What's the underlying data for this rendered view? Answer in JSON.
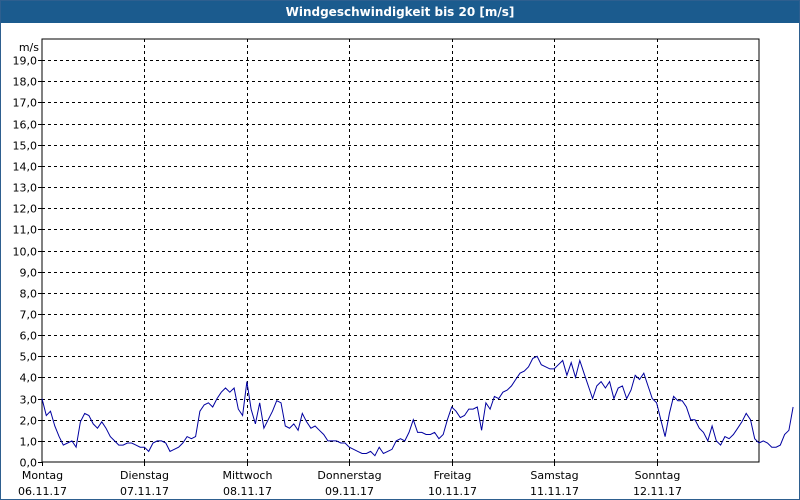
{
  "window": {
    "title": "Windgeschwindigkeit bis 20 [m/s]"
  },
  "chart_data": {
    "type": "line",
    "title": "Windgeschwindigkeit bis 20 [m/s]",
    "ylabel": "m/s",
    "ylim": [
      0,
      20
    ],
    "yticks": [
      "0,0",
      "1,0",
      "2,0",
      "3,0",
      "4,0",
      "5,0",
      "6,0",
      "7,0",
      "8,0",
      "9,0",
      "10,0",
      "11,0",
      "12,0",
      "13,0",
      "14,0",
      "15,0",
      "16,0",
      "17,0",
      "18,0",
      "19,0"
    ],
    "x_days": [
      {
        "day": "Montag",
        "date": "06.11.17"
      },
      {
        "day": "Dienstag",
        "date": "07.11.17"
      },
      {
        "day": "Mittwoch",
        "date": "08.11.17"
      },
      {
        "day": "Donnerstag",
        "date": "09.11.17"
      },
      {
        "day": "Freitag",
        "date": "10.11.17"
      },
      {
        "day": "Samstag",
        "date": "11.11.17"
      },
      {
        "day": "Sonntag",
        "date": "12.11.17"
      }
    ],
    "grid": true,
    "line_color": "#0000a0",
    "series": [
      {
        "points_per_day": 24,
        "values": [
          3.0,
          2.2,
          2.4,
          1.7,
          1.2,
          0.8,
          0.9,
          1.0,
          0.7,
          1.9,
          2.3,
          2.2,
          1.8,
          1.6,
          1.9,
          1.6,
          1.2,
          1.0,
          0.8,
          0.8,
          0.9,
          0.9,
          0.8,
          0.7,
          0.7,
          0.5,
          0.9,
          1.0,
          1.0,
          0.9,
          0.5,
          0.6,
          0.7,
          0.9,
          1.2,
          1.1,
          1.2,
          2.4,
          2.7,
          2.8,
          2.6,
          3.0,
          3.3,
          3.5,
          3.3,
          3.5,
          2.5,
          2.2,
          3.8,
          2.5,
          1.8,
          2.8,
          1.6,
          2.0,
          2.4,
          2.9,
          2.8,
          1.7,
          1.6,
          1.8,
          1.5,
          2.3,
          1.9,
          1.6,
          1.7,
          1.5,
          1.3,
          1.0,
          1.0,
          1.0,
          0.9,
          0.9,
          0.7,
          0.6,
          0.5,
          0.4,
          0.4,
          0.5,
          0.3,
          0.7,
          0.4,
          0.5,
          0.6,
          1.0,
          1.1,
          1.0,
          1.4,
          2.0,
          1.4,
          1.4,
          1.3,
          1.3,
          1.4,
          1.1,
          1.3,
          2.0,
          2.6,
          2.4,
          2.1,
          2.2,
          2.5,
          2.5,
          2.6,
          1.5,
          2.8,
          2.5,
          3.1,
          3.0,
          3.3,
          3.4,
          3.6,
          3.9,
          4.2,
          4.3,
          4.5,
          4.9,
          5.0,
          4.6,
          4.5,
          4.4,
          4.4,
          4.6,
          4.8,
          4.1,
          4.7,
          4.0,
          4.8,
          4.2,
          3.6,
          3.0,
          3.6,
          3.8,
          3.5,
          3.8,
          3.0,
          3.5,
          3.6,
          3.0,
          3.4,
          4.1,
          3.9,
          4.2,
          3.6,
          3.0,
          2.8,
          2.0,
          1.2,
          2.3,
          3.1,
          2.9,
          2.9,
          2.6,
          2.0,
          2.0,
          1.6,
          1.4,
          1.0,
          1.7,
          1.0,
          0.8,
          1.2,
          1.1,
          1.3,
          1.6,
          1.9,
          2.3,
          2.0,
          1.1,
          0.9,
          1.0,
          0.9,
          0.7,
          0.7,
          0.8,
          1.3,
          1.5,
          2.6
        ]
      }
    ]
  }
}
